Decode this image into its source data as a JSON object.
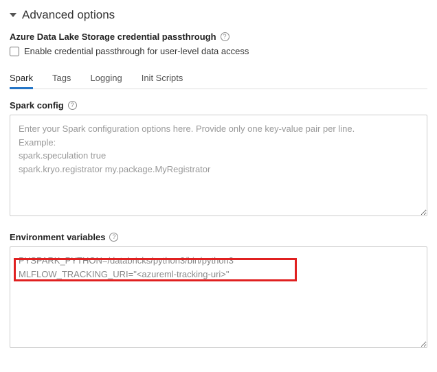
{
  "header": {
    "title": "Advanced options"
  },
  "passthrough": {
    "label": "Azure Data Lake Storage credential passthrough",
    "checkbox_label": "Enable credential passthrough for user-level data access"
  },
  "tabs": {
    "spark": "Spark",
    "tags": "Tags",
    "logging": "Logging",
    "init_scripts": "Init Scripts"
  },
  "spark_config": {
    "label": "Spark config",
    "placeholder": "Enter your Spark configuration options here. Provide only one key-value pair per line.\nExample:\nspark.speculation true\nspark.kryo.registrator my.package.MyRegistrator",
    "value": ""
  },
  "env_vars": {
    "label": "Environment variables",
    "value": "PYSPARK_PYTHON=/databricks/python3/bin/python3\nMLFLOW_TRACKING_URI=\"<azureml-tracking-uri>\""
  }
}
